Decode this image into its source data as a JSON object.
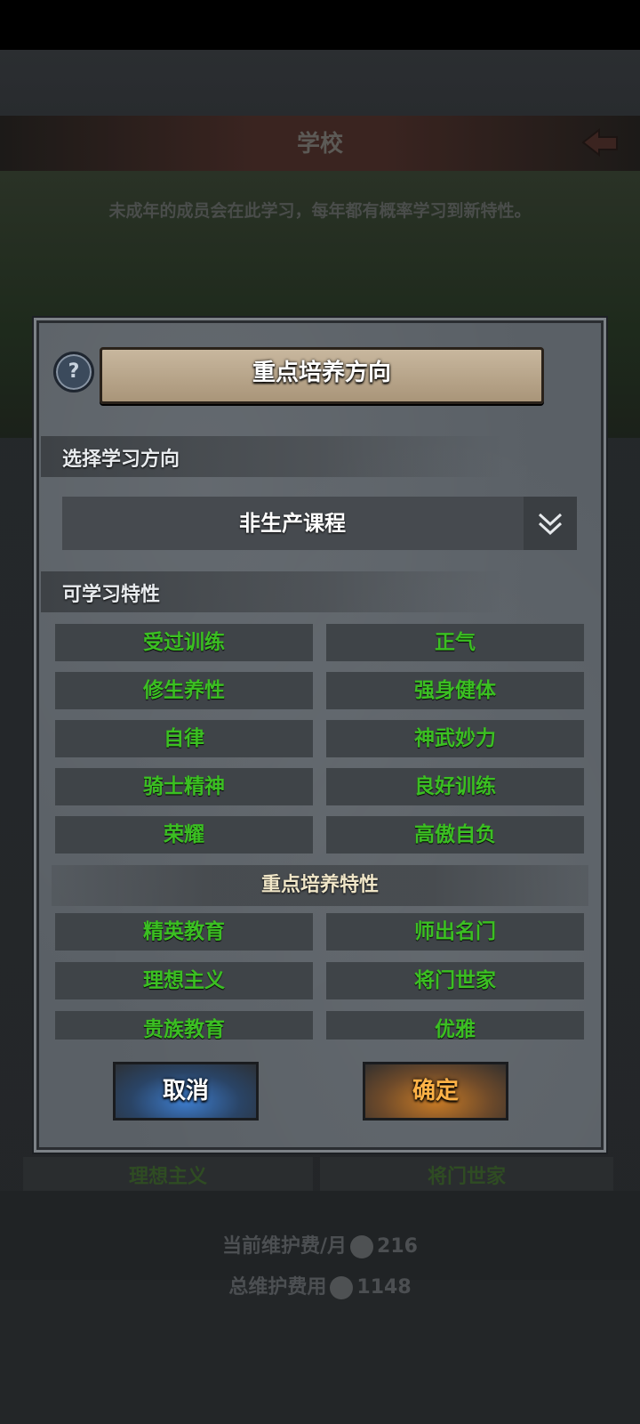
{
  "background": {
    "title": "学校",
    "description": "未成年的成员会在此学习，每年都有概率学习到新特性。",
    "behind_rows": [
      "理想主义",
      "将门世家"
    ],
    "footer": {
      "monthly_label": "当前维护费/月",
      "monthly_value": "216",
      "total_label": "总维护费用",
      "total_value": "1148"
    }
  },
  "dialog": {
    "title": "重点培养方向",
    "help_icon_text": "?",
    "direction_section": "选择学习方向",
    "direction_selected": "非生产课程",
    "learnable_section": "可学习特性",
    "learnable_traits": [
      [
        "受过训练",
        "正气"
      ],
      [
        "修生养性",
        "强身健体"
      ],
      [
        "自律",
        "神武妙力"
      ],
      [
        "骑士精神",
        "良好训练"
      ],
      [
        "荣耀",
        "高傲自负"
      ]
    ],
    "focus_section": "重点培养特性",
    "focus_traits": [
      [
        "精英教育",
        "师出名门"
      ],
      [
        "理想主义",
        "将门世家"
      ],
      [
        "贵族教育",
        "优雅"
      ]
    ],
    "cancel_label": "取消",
    "confirm_label": "确定"
  },
  "colors": {
    "trait_text": "#3bbf22",
    "confirm_text": "#ffb347",
    "panel": "#5a6066"
  }
}
